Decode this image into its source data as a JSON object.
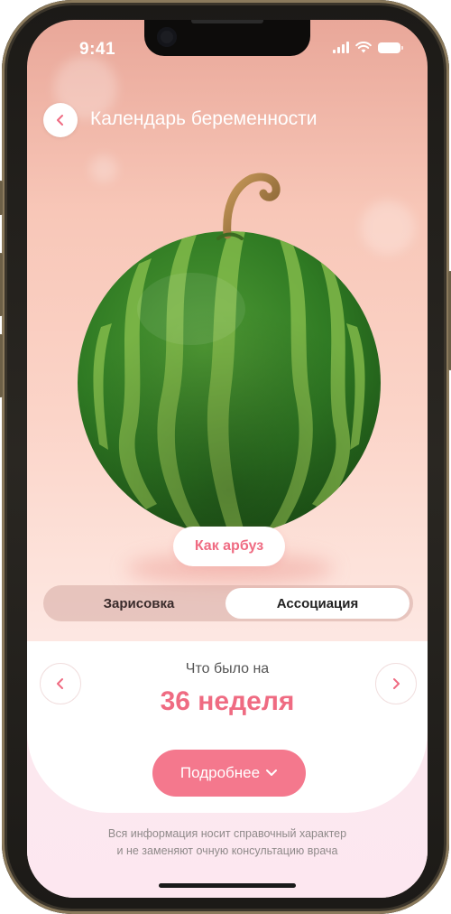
{
  "status_bar": {
    "time": "9:41"
  },
  "header": {
    "title": "Календарь беременности",
    "back_icon": "chevron-left-icon"
  },
  "fruit": {
    "image": "watermelon"
  },
  "association_badge": {
    "label": "Как арбуз"
  },
  "tabs": {
    "items": [
      {
        "label": "Зарисовка",
        "selected": false
      },
      {
        "label": "Ассоциация",
        "selected": true
      }
    ]
  },
  "week": {
    "caption": "Что было на",
    "title": "36 неделя",
    "prev_icon": "chevron-left-icon",
    "next_icon": "chevron-right-icon"
  },
  "more_button": {
    "label": "Подробнее",
    "icon": "chevron-down-icon"
  },
  "disclaimer": {
    "line1": "Вся информация носит справочный характер",
    "line2": "и не заменяют очную консультацию врача"
  },
  "colors": {
    "accent": "#ef6b82",
    "button": "#f4788d",
    "background_top": "#e9a799",
    "background_bottom": "#fde7f0"
  }
}
